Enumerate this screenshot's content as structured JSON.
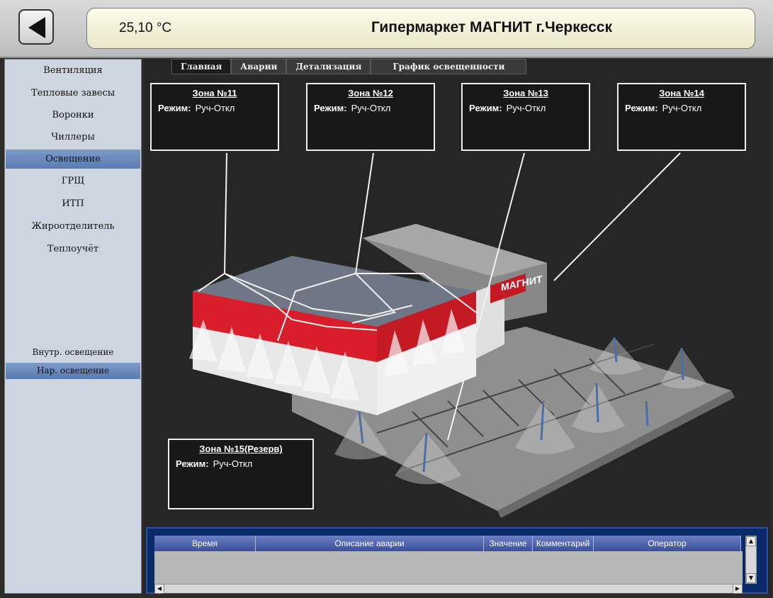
{
  "header": {
    "temperature": "25,10 °C",
    "title": "Гипермаркет МАГНИТ г.Черкесск"
  },
  "icons": {
    "back": "back-arrow-icon"
  },
  "sidebar": {
    "items": [
      {
        "label": "Вентиляция"
      },
      {
        "label": "Тепловые завесы"
      },
      {
        "label": "Воронки"
      },
      {
        "label": "Чиллеры"
      },
      {
        "label": "Освещение",
        "active": true
      },
      {
        "label": "ГРЩ"
      },
      {
        "label": "ИТП"
      },
      {
        "label": "Жироотделитель"
      },
      {
        "label": "Теплоучёт"
      }
    ],
    "sub_items": [
      {
        "label": "Внутр. освещение"
      },
      {
        "label": "Нар. освещение",
        "active": true
      }
    ]
  },
  "tabs": [
    {
      "label": "Главная",
      "active": true
    },
    {
      "label": "Аварии"
    },
    {
      "label": "Детализация"
    },
    {
      "label": "График освещенности"
    }
  ],
  "zones": [
    {
      "title": "Зона №11",
      "mode_label": "Режим:",
      "mode": "Руч-Откл"
    },
    {
      "title": "Зона №12",
      "mode_label": "Режим:",
      "mode": "Руч-Откл"
    },
    {
      "title": "Зона №13",
      "mode_label": "Режим:",
      "mode": "Руч-Откл"
    },
    {
      "title": "Зона №14",
      "mode_label": "Режим:",
      "mode": "Руч-Откл"
    },
    {
      "title": "Зона №15(Резерв)",
      "mode_label": "Режим:",
      "mode": "Руч-Откл"
    }
  ],
  "building": {
    "sign": "МАГНИТ"
  },
  "alarm_table": {
    "columns": [
      "Время",
      "Описание аварии",
      "Значение",
      "Комментарий",
      "Оператор"
    ]
  },
  "colors": {
    "accent": "#5a7bb0",
    "building_red": "#d81e2a",
    "roof": "#6f7685",
    "alarm_frame": "#0b2a6a"
  }
}
